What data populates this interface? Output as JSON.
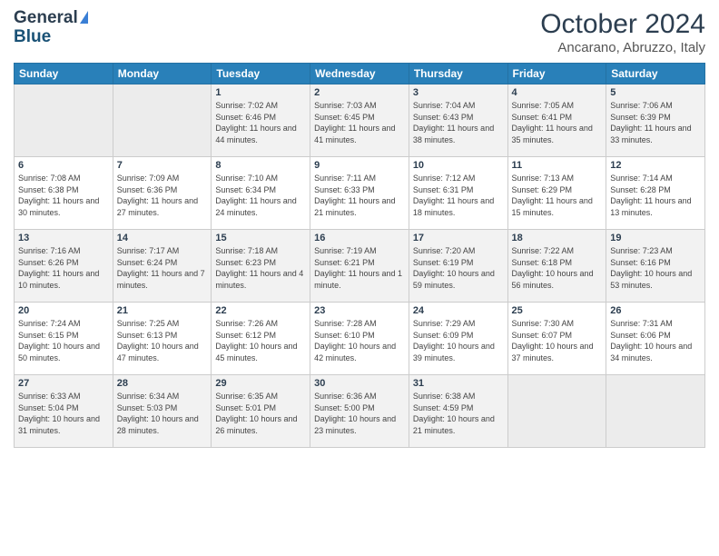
{
  "header": {
    "logo_general": "General",
    "logo_blue": "Blue",
    "month": "October 2024",
    "location": "Ancarano, Abruzzo, Italy"
  },
  "days_of_week": [
    "Sunday",
    "Monday",
    "Tuesday",
    "Wednesday",
    "Thursday",
    "Friday",
    "Saturday"
  ],
  "weeks": [
    [
      {
        "day": "",
        "info": ""
      },
      {
        "day": "",
        "info": ""
      },
      {
        "day": "1",
        "info": "Sunrise: 7:02 AM\nSunset: 6:46 PM\nDaylight: 11 hours and 44 minutes."
      },
      {
        "day": "2",
        "info": "Sunrise: 7:03 AM\nSunset: 6:45 PM\nDaylight: 11 hours and 41 minutes."
      },
      {
        "day": "3",
        "info": "Sunrise: 7:04 AM\nSunset: 6:43 PM\nDaylight: 11 hours and 38 minutes."
      },
      {
        "day": "4",
        "info": "Sunrise: 7:05 AM\nSunset: 6:41 PM\nDaylight: 11 hours and 35 minutes."
      },
      {
        "day": "5",
        "info": "Sunrise: 7:06 AM\nSunset: 6:39 PM\nDaylight: 11 hours and 33 minutes."
      }
    ],
    [
      {
        "day": "6",
        "info": "Sunrise: 7:08 AM\nSunset: 6:38 PM\nDaylight: 11 hours and 30 minutes."
      },
      {
        "day": "7",
        "info": "Sunrise: 7:09 AM\nSunset: 6:36 PM\nDaylight: 11 hours and 27 minutes."
      },
      {
        "day": "8",
        "info": "Sunrise: 7:10 AM\nSunset: 6:34 PM\nDaylight: 11 hours and 24 minutes."
      },
      {
        "day": "9",
        "info": "Sunrise: 7:11 AM\nSunset: 6:33 PM\nDaylight: 11 hours and 21 minutes."
      },
      {
        "day": "10",
        "info": "Sunrise: 7:12 AM\nSunset: 6:31 PM\nDaylight: 11 hours and 18 minutes."
      },
      {
        "day": "11",
        "info": "Sunrise: 7:13 AM\nSunset: 6:29 PM\nDaylight: 11 hours and 15 minutes."
      },
      {
        "day": "12",
        "info": "Sunrise: 7:14 AM\nSunset: 6:28 PM\nDaylight: 11 hours and 13 minutes."
      }
    ],
    [
      {
        "day": "13",
        "info": "Sunrise: 7:16 AM\nSunset: 6:26 PM\nDaylight: 11 hours and 10 minutes."
      },
      {
        "day": "14",
        "info": "Sunrise: 7:17 AM\nSunset: 6:24 PM\nDaylight: 11 hours and 7 minutes."
      },
      {
        "day": "15",
        "info": "Sunrise: 7:18 AM\nSunset: 6:23 PM\nDaylight: 11 hours and 4 minutes."
      },
      {
        "day": "16",
        "info": "Sunrise: 7:19 AM\nSunset: 6:21 PM\nDaylight: 11 hours and 1 minute."
      },
      {
        "day": "17",
        "info": "Sunrise: 7:20 AM\nSunset: 6:19 PM\nDaylight: 10 hours and 59 minutes."
      },
      {
        "day": "18",
        "info": "Sunrise: 7:22 AM\nSunset: 6:18 PM\nDaylight: 10 hours and 56 minutes."
      },
      {
        "day": "19",
        "info": "Sunrise: 7:23 AM\nSunset: 6:16 PM\nDaylight: 10 hours and 53 minutes."
      }
    ],
    [
      {
        "day": "20",
        "info": "Sunrise: 7:24 AM\nSunset: 6:15 PM\nDaylight: 10 hours and 50 minutes."
      },
      {
        "day": "21",
        "info": "Sunrise: 7:25 AM\nSunset: 6:13 PM\nDaylight: 10 hours and 47 minutes."
      },
      {
        "day": "22",
        "info": "Sunrise: 7:26 AM\nSunset: 6:12 PM\nDaylight: 10 hours and 45 minutes."
      },
      {
        "day": "23",
        "info": "Sunrise: 7:28 AM\nSunset: 6:10 PM\nDaylight: 10 hours and 42 minutes."
      },
      {
        "day": "24",
        "info": "Sunrise: 7:29 AM\nSunset: 6:09 PM\nDaylight: 10 hours and 39 minutes."
      },
      {
        "day": "25",
        "info": "Sunrise: 7:30 AM\nSunset: 6:07 PM\nDaylight: 10 hours and 37 minutes."
      },
      {
        "day": "26",
        "info": "Sunrise: 7:31 AM\nSunset: 6:06 PM\nDaylight: 10 hours and 34 minutes."
      }
    ],
    [
      {
        "day": "27",
        "info": "Sunrise: 6:33 AM\nSunset: 5:04 PM\nDaylight: 10 hours and 31 minutes."
      },
      {
        "day": "28",
        "info": "Sunrise: 6:34 AM\nSunset: 5:03 PM\nDaylight: 10 hours and 28 minutes."
      },
      {
        "day": "29",
        "info": "Sunrise: 6:35 AM\nSunset: 5:01 PM\nDaylight: 10 hours and 26 minutes."
      },
      {
        "day": "30",
        "info": "Sunrise: 6:36 AM\nSunset: 5:00 PM\nDaylight: 10 hours and 23 minutes."
      },
      {
        "day": "31",
        "info": "Sunrise: 6:38 AM\nSunset: 4:59 PM\nDaylight: 10 hours and 21 minutes."
      },
      {
        "day": "",
        "info": ""
      },
      {
        "day": "",
        "info": ""
      }
    ]
  ]
}
